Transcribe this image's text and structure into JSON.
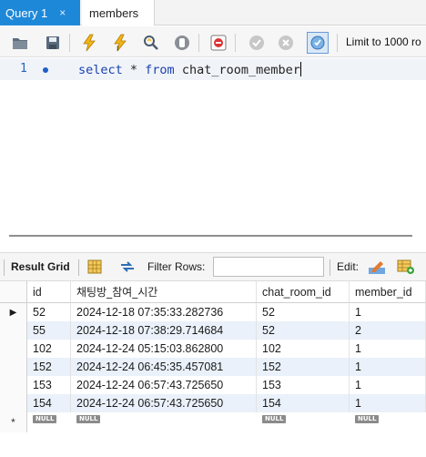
{
  "tabs": [
    {
      "label": "Query 1",
      "close": "×",
      "active": true
    },
    {
      "label": "members",
      "active": false
    }
  ],
  "toolbar": {
    "icons": [
      "open-folder-icon",
      "save-icon",
      "execute-icon",
      "execute-current-icon",
      "explain-icon",
      "stop-icon",
      "stop-on-error-icon",
      "commit-icon",
      "rollback-icon",
      "autocommit-icon"
    ],
    "limit_label": "Limit to 1000 ro"
  },
  "editor": {
    "line_number": "1",
    "tokens": [
      {
        "text": "select",
        "kind": "keyword"
      },
      {
        "text": " * ",
        "kind": "op"
      },
      {
        "text": "from",
        "kind": "keyword"
      },
      {
        "text": " chat_room_member",
        "kind": "ident"
      }
    ]
  },
  "result_toolbar": {
    "result_grid_label": "Result Grid",
    "filter_rows_label": "Filter Rows:",
    "filter_value": "",
    "edit_label": "Edit:"
  },
  "grid": {
    "columns": [
      "id",
      "채팅방_참여_시간",
      "chat_room_id",
      "member_id"
    ],
    "rows": [
      [
        "52",
        "2024-12-18 07:35:33.282736",
        "52",
        "1"
      ],
      [
        "55",
        "2024-12-18 07:38:29.714684",
        "52",
        "2"
      ],
      [
        "102",
        "2024-12-24 05:15:03.862800",
        "102",
        "1"
      ],
      [
        "152",
        "2024-12-24 06:45:35.457081",
        "152",
        "1"
      ],
      [
        "153",
        "2024-12-24 06:57:43.725650",
        "153",
        "1"
      ],
      [
        "154",
        "2024-12-24 06:57:43.725650",
        "154",
        "1"
      ]
    ],
    "null_label": "NULL",
    "new_row_marker": "*",
    "current_row_marker": "▶"
  },
  "colors": {
    "active_tab": "#1e88d8",
    "keyword": "#1a3fb0",
    "row_stripe": "#eaf1fa"
  }
}
